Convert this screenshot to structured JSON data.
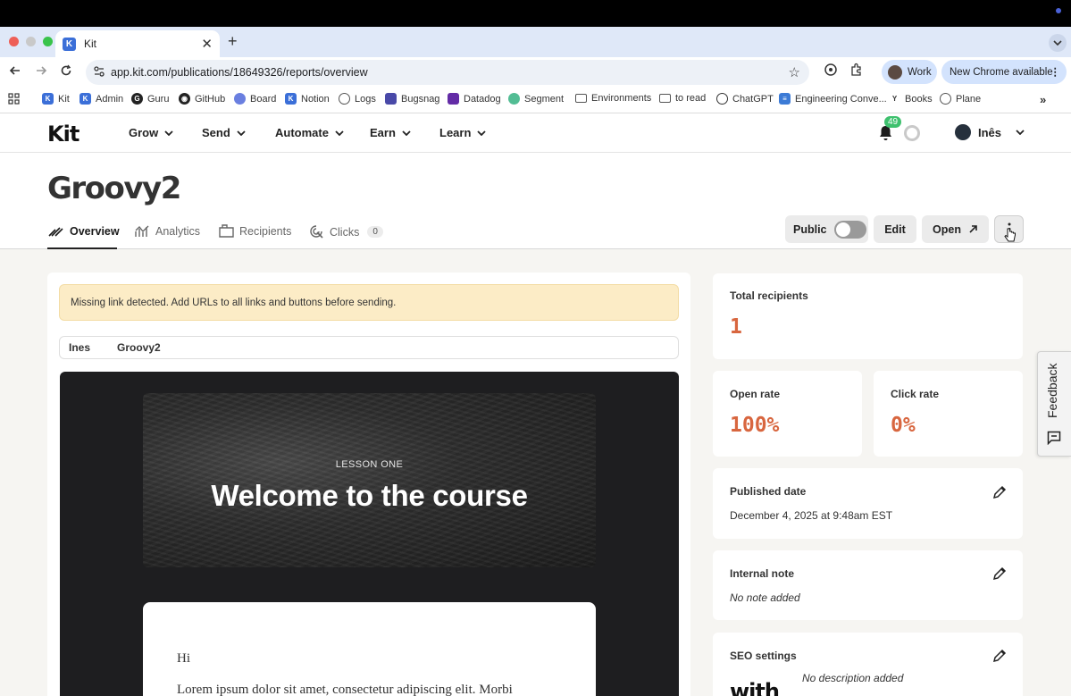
{
  "browser": {
    "tab_title": "Kit",
    "url": "app.kit.com/publications/18649326/reports/overview",
    "profile_label": "Work",
    "update_label": "New Chrome available",
    "bookmarks": [
      "Kit",
      "Admin",
      "Guru",
      "GitHub",
      "Board",
      "Notion",
      "Logs",
      "Bugsnag",
      "Datadog",
      "Segment",
      "Environments",
      "to read",
      "ChatGPT",
      "Engineering Conve...",
      "Books",
      "Plane"
    ]
  },
  "app": {
    "logo": "Kit",
    "nav": [
      "Grow",
      "Send",
      "Automate",
      "Earn",
      "Learn"
    ],
    "notification_count": "49",
    "user_name": "Inês"
  },
  "page": {
    "title": "Groovy2",
    "tabs": {
      "overview": "Overview",
      "analytics": "Analytics",
      "recipients": "Recipients",
      "clicks": "Clicks",
      "clicks_count": "0"
    },
    "actions": {
      "public_label": "Public",
      "edit_label": "Edit",
      "open_label": "Open"
    }
  },
  "email": {
    "warning": "Missing link detected. Add URLs to all links and buttons before sending.",
    "from_name": "Ines",
    "subject": "Groovy2",
    "eyebrow": "LESSON ONE",
    "hero_title": "Welcome to the course",
    "greeting": "Hi",
    "body_preview": "Lorem ipsum dolor sit amet, consectetur adipiscing elit. Morbi"
  },
  "stats": {
    "total_recipients_label": "Total recipients",
    "total_recipients": "1",
    "open_rate_label": "Open rate",
    "open_rate": "100%",
    "click_rate_label": "Click rate",
    "click_rate": "0%",
    "published_label": "Published date",
    "published_value": "December 4, 2025 at 9:48am EST",
    "note_label": "Internal note",
    "note_value": "No note added",
    "seo_label": "SEO settings",
    "seo_value": "No description added",
    "seo_thumb": "with"
  },
  "feedback": {
    "label": "Feedback"
  },
  "colors": {
    "accent": "#d8663f",
    "warning_bg": "#fcecc6",
    "badge_green": "#3ec16e"
  }
}
